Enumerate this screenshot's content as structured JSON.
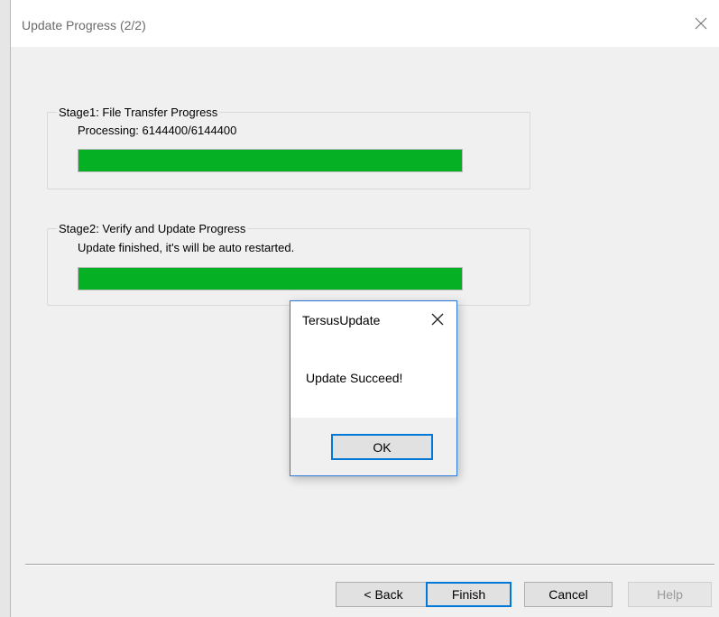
{
  "window": {
    "title": "Update Progress (2/2)",
    "close_icon": "close-icon"
  },
  "stage1": {
    "title": "Stage1: File Transfer Progress",
    "status": "Processing: 6144400/6144400",
    "progress": 1.0
  },
  "stage2": {
    "title": "Stage2: Verify and Update Progress",
    "status": "Update finished, it's will be auto restarted.",
    "progress": 1.0
  },
  "buttons": {
    "back": "< Back",
    "finish": "Finish",
    "cancel": "Cancel",
    "help": "Help"
  },
  "dialog": {
    "title": "TersusUpdate",
    "message": "Update Succeed!",
    "ok": "OK",
    "close_icon": "close-icon"
  },
  "colors": {
    "progress_fill": "#06b025",
    "focus_border": "#0078d7"
  }
}
